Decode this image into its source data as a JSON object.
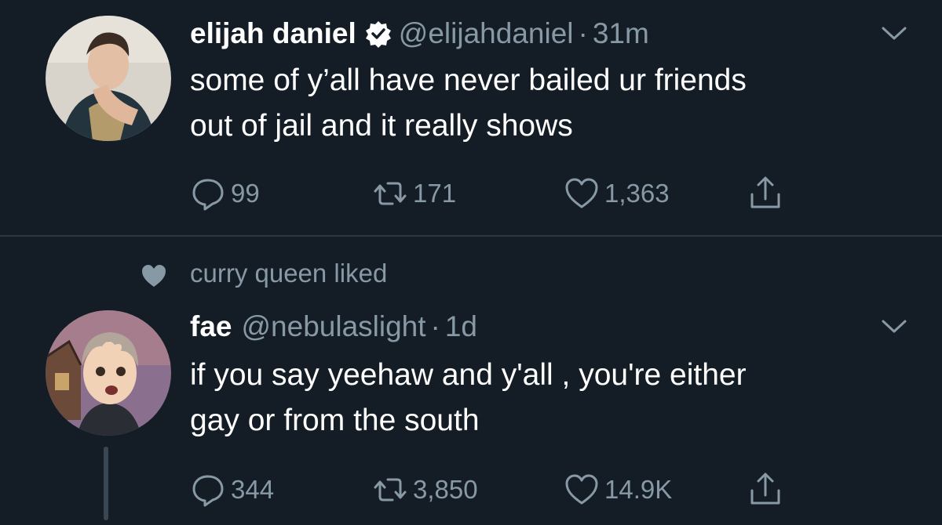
{
  "tweets": [
    {
      "name": "elijah daniel",
      "verified": true,
      "handle": "@elijahdaniel",
      "separator": "·",
      "time": "31m",
      "lines": [
        "some of y’all have never bailed ur friends",
        "out of jail and it really shows"
      ],
      "replies": "99",
      "retweets": "171",
      "likes": "1,363"
    },
    {
      "social_context": "curry queen liked",
      "name": "fae",
      "verified": false,
      "handle": "@nebulaslight",
      "separator": "·",
      "time": "1d",
      "lines": [
        "if you say yeehaw and y'all , you're either",
        "gay or from the south"
      ],
      "replies": "344",
      "retweets": "3,850",
      "likes": "14.9K"
    }
  ],
  "colors": {
    "background": "#141d26",
    "secondary": "#8899a6",
    "primary_text": "#ffffff",
    "divider": "#2b3743"
  },
  "icons": [
    "verified-badge-icon",
    "chevron-down-icon",
    "reply-icon",
    "retweet-icon",
    "like-icon",
    "share-icon",
    "heart-filled-icon"
  ]
}
